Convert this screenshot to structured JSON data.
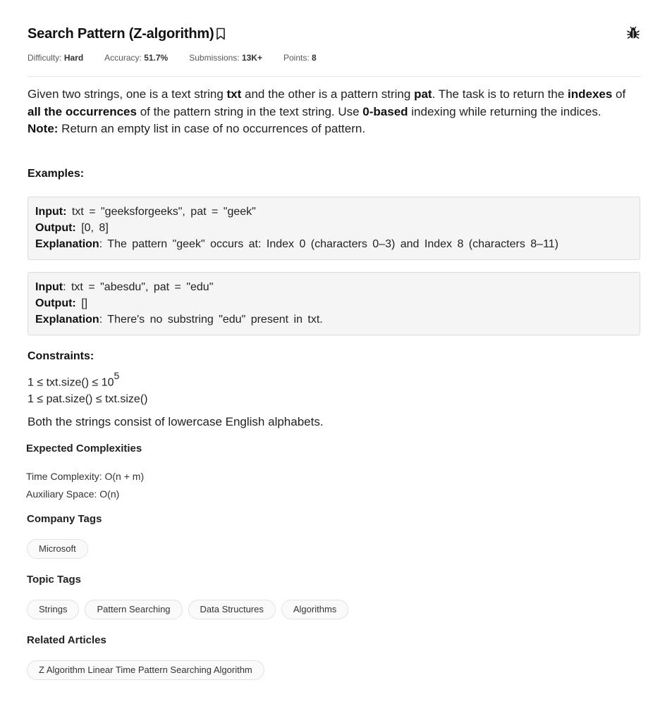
{
  "problem": {
    "title": "Search Pattern (Z-algorithm)",
    "meta": {
      "difficulty_label": "Difficulty:",
      "difficulty": "Hard",
      "accuracy_label": "Accuracy:",
      "accuracy": "51.7%",
      "submissions_label": "Submissions:",
      "submissions": "13K+",
      "points_label": "Points:",
      "points": "8"
    }
  },
  "description": {
    "p1": "Given two strings, one is a text string ",
    "txt": "txt",
    "p2": " and the other is a pattern string ",
    "pat": "pat",
    "p3": ". The task is to return the ",
    "indexes": "indexes",
    "p4": " of ",
    "all_occ": "all the occurrences",
    "p5": " of the pattern string in the text string. Use ",
    "zero_based": "0-based",
    "p6": " indexing while returning the indices.",
    "note_label": "Note:",
    "note": " Return an empty list in case of no occurrences of pattern."
  },
  "examples": {
    "heading": "Examples:",
    "ex1": {
      "input_label": "Input:",
      "input": " txt = \"geeksforgeeks\", pat = \"geek\"",
      "output_label": "Output:",
      "output": " [0, 8]",
      "explanation_label": "Explanation",
      "explanation": ": The pattern \"geek\" occurs at: Index 0 (characters 0–3) and Index 8 (characters 8–11)"
    },
    "ex2": {
      "input_label": "Input",
      "input": ": txt = \"abesdu\", pat = \"edu\"",
      "output_label": "Output:",
      "output": " []",
      "explanation_label": "Explanation",
      "explanation": ": There's no substring \"edu\" present in txt."
    }
  },
  "constraints": {
    "heading": "Constraints:",
    "c1": "1 ≤ txt.size() ≤ 10",
    "c1_exp": "5",
    "c2": "1 ≤ pat.size() ≤ txt.size()",
    "c3": "Both the strings consist of lowercase English alphabets."
  },
  "complexities": {
    "heading": "Expected Complexities",
    "time": "Time Complexity: O(n + m)",
    "space": "Auxiliary Space: O(n)"
  },
  "company_tags": {
    "heading": "Company Tags",
    "items": [
      "Microsoft"
    ]
  },
  "topic_tags": {
    "heading": "Topic Tags",
    "items": [
      "Strings",
      "Pattern Searching",
      "Data Structures",
      "Algorithms"
    ]
  },
  "related_articles": {
    "heading": "Related Articles",
    "items": [
      "Z Algorithm Linear Time Pattern Searching Algorithm"
    ]
  },
  "icons": {
    "bookmark": "bookmark-icon",
    "bug": "bug-icon"
  }
}
